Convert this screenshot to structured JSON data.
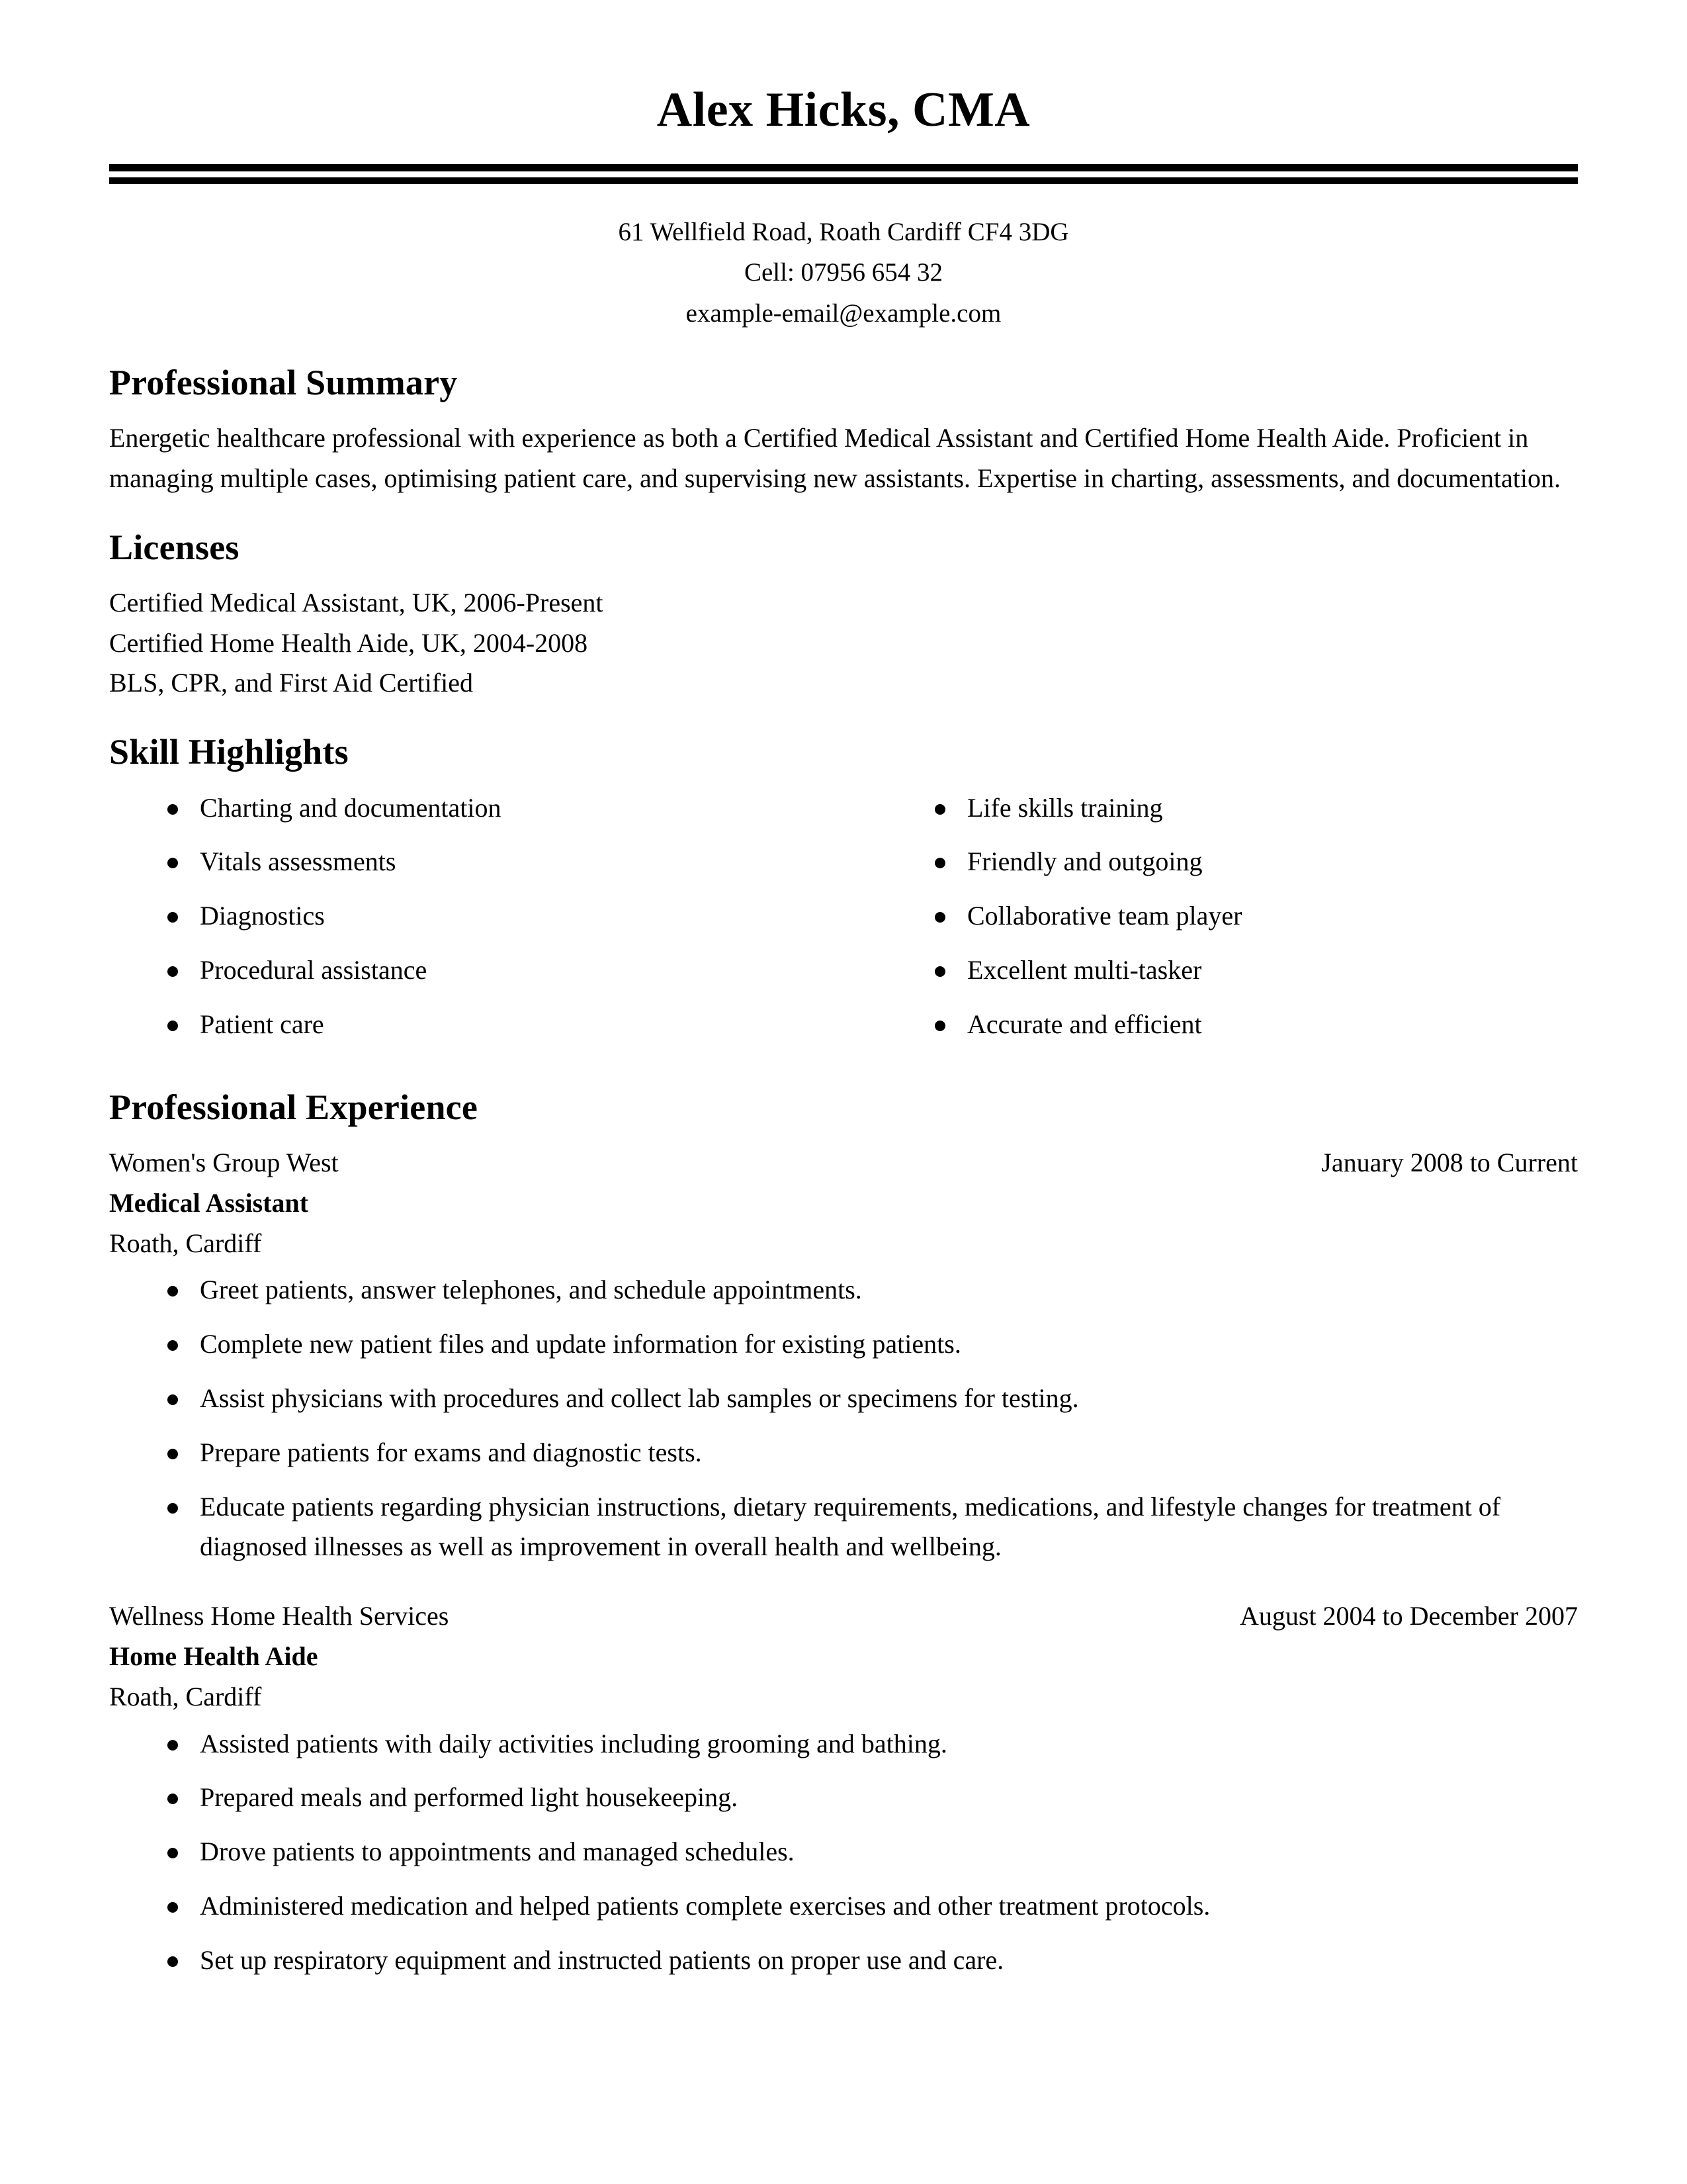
{
  "header": {
    "name": "Alex Hicks, CMA",
    "contact": [
      "61 Wellfield Road, Roath Cardiff CF4 3DG",
      "Cell: 07956 654 32",
      "example-email@example.com"
    ]
  },
  "sections": {
    "summary": {
      "title": "Professional Summary",
      "text": "Energetic healthcare professional with experience as both a Certified Medical Assistant and Certified Home Health Aide. Proficient in managing multiple cases, optimising patient care, and supervising new assistants. Expertise in charting, assessments, and documentation."
    },
    "licenses": {
      "title": "Licenses",
      "items": [
        "Certified Medical Assistant, UK, 2006-Present",
        "Certified Home Health Aide, UK, 2004-2008",
        "BLS, CPR, and First Aid Certified"
      ]
    },
    "skills": {
      "title": "Skill Highlights",
      "left": [
        "Charting and documentation",
        "Vitals assessments",
        "Diagnostics",
        "Procedural assistance",
        "Patient care"
      ],
      "right": [
        "Life skills training",
        "Friendly and outgoing",
        "Collaborative team player",
        "Excellent multi-tasker",
        "Accurate and efficient"
      ]
    },
    "experience": {
      "title": "Professional Experience",
      "jobs": [
        {
          "company": "Women's Group West",
          "dates": "January 2008 to Current",
          "title": "Medical Assistant",
          "location": "Roath, Cardiff",
          "bullets": [
            "Greet patients, answer telephones, and schedule appointments.",
            "Complete new patient files and update information for existing patients.",
            "Assist physicians with procedures and collect lab samples or specimens for testing.",
            "Prepare patients for exams and diagnostic tests.",
            "Educate patients regarding physician instructions, dietary requirements, medications, and lifestyle changes for treatment of diagnosed illnesses as well as improvement in overall health and wellbeing."
          ]
        },
        {
          "company": "Wellness Home Health Services",
          "dates": "August 2004 to December 2007",
          "title": "Home Health Aide",
          "location": "Roath, Cardiff",
          "bullets": [
            "Assisted patients with daily activities including grooming and bathing.",
            "Prepared meals and performed light housekeeping.",
            "Drove patients to appointments and managed schedules.",
            "Administered medication and helped patients complete exercises and other treatment protocols.",
            "Set up respiratory equipment and instructed patients on proper use and care."
          ]
        }
      ]
    }
  },
  "colors": {
    "text": "#000000",
    "page_background": "#ffffff",
    "rule": "#000000"
  }
}
